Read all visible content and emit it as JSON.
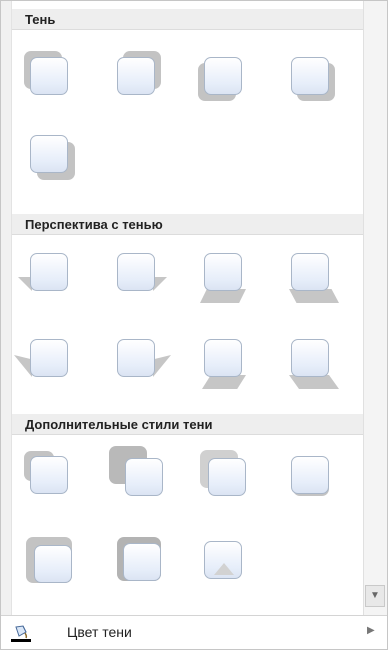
{
  "sections": {
    "shadow": {
      "title": "Тень"
    },
    "perspective": {
      "title": "Перспектива с тенью"
    },
    "additional": {
      "title": "Дополнительные стили тени"
    }
  },
  "footer": {
    "label": "Цвет тени",
    "icon": "paint-bucket-icon",
    "arrow_icon": "chevron-right-icon"
  },
  "scrollbar": {
    "down_arrow": "▼"
  },
  "colors": {
    "tile_fill": "#e7eefa",
    "tile_border": "#a9b6c8",
    "shadow": "#c3c3c3",
    "header_bg": "#eeeeee"
  }
}
